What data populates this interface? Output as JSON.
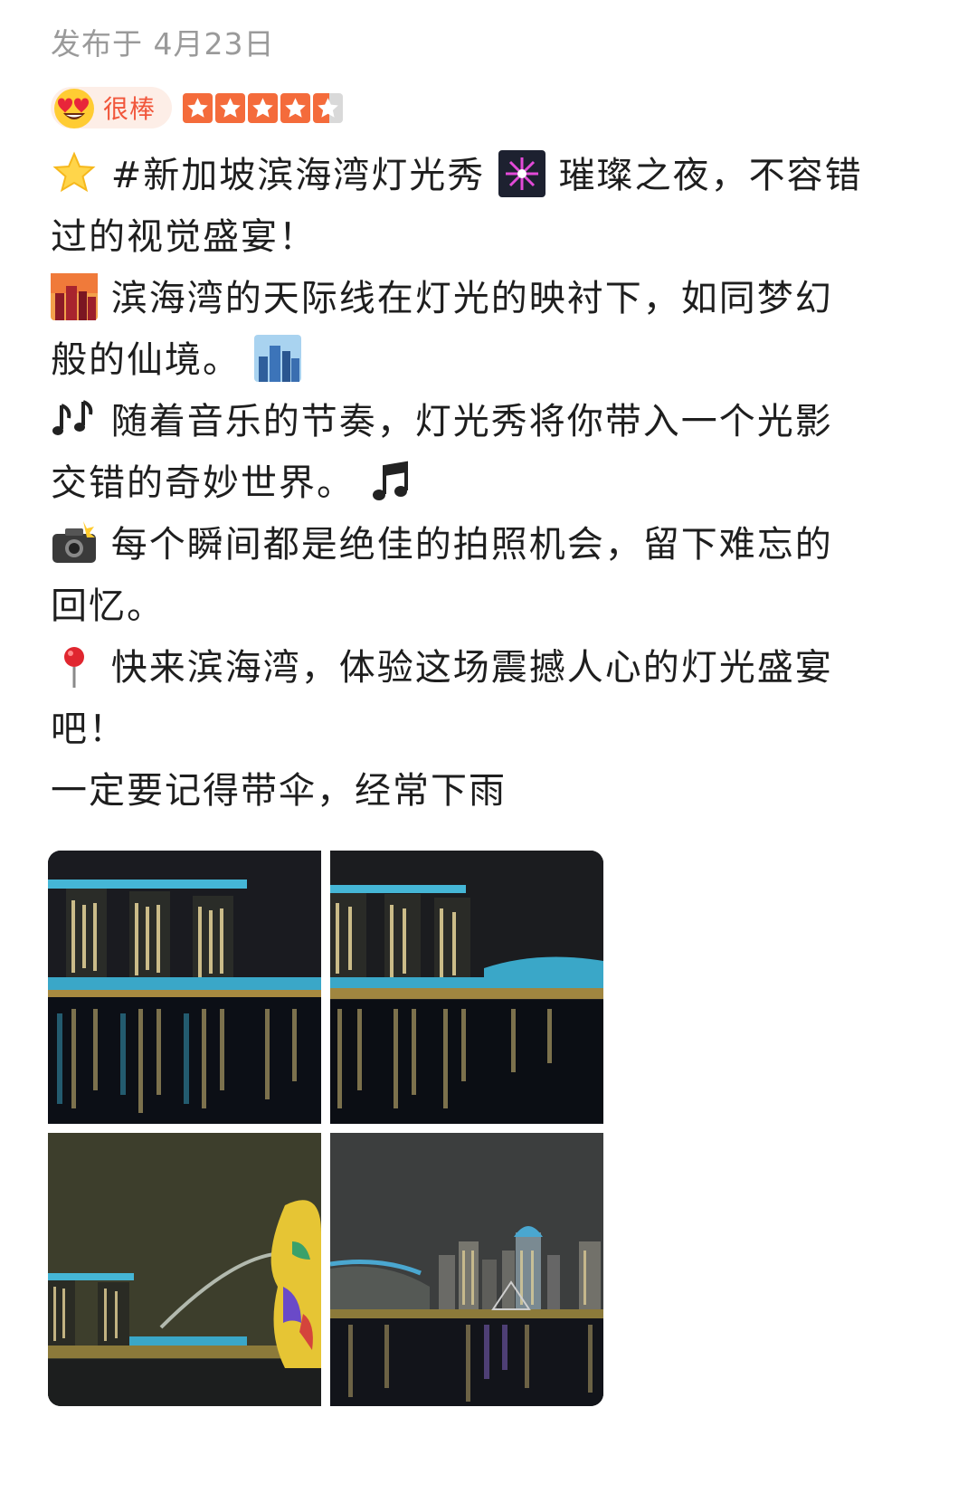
{
  "post": {
    "date": "发布于 4月23日",
    "rating_label": "很棒",
    "rating_emoji": "heart-eyes-emoji",
    "stars": 4.5,
    "stars_max": 5,
    "accent_color": "#f46b3b"
  },
  "content_lines": [
    {
      "icon": "glowing-star-icon",
      "text": "#新加坡滨海湾灯光秀",
      "icon2": "fireworks-icon",
      "text2": "璀璨之夜，不容错"
    },
    {
      "text": "过的视觉盛宴！"
    },
    {
      "icon": "city-sunset-icon",
      "text": "滨海湾的天际线在灯光的映衬下，如同梦幻"
    },
    {
      "text": "般的仙境。",
      "icon2": "cityscape-icon"
    },
    {
      "icon": "music-notes-icon",
      "text": "随着音乐的节奏，灯光秀将你带入一个光影"
    },
    {
      "text": "交错的奇妙世界。",
      "icon2": "music-note-icon"
    },
    {
      "icon": "camera-flash-icon",
      "text": "每个瞬间都是绝佳的拍照机会，留下难忘的"
    },
    {
      "text": "回忆。"
    },
    {
      "icon": "pin-icon",
      "text": "快来滨海湾，体验这场震撼人心的灯光盛宴"
    },
    {
      "text": "吧！"
    },
    {
      "text": "一定要记得带伞，经常下雨"
    }
  ],
  "photos": [
    {
      "subject": "marina-bay-sands-night"
    },
    {
      "subject": "marina-bay-sands-reflection"
    },
    {
      "subject": "merlion-fountain"
    },
    {
      "subject": "city-skyline-night"
    }
  ]
}
